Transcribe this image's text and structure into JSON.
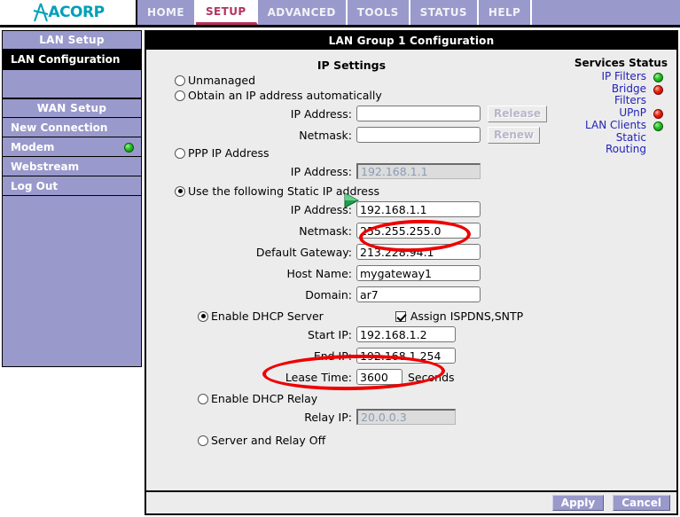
{
  "brand": {
    "name": "ACORP",
    "logo_icon": "acorp-logo-icon"
  },
  "nav": {
    "items": [
      {
        "label": "HOME",
        "active": false
      },
      {
        "label": "SETUP",
        "active": true
      },
      {
        "label": "ADVANCED",
        "active": false
      },
      {
        "label": "TOOLS",
        "active": false
      },
      {
        "label": "STATUS",
        "active": false
      },
      {
        "label": "HELP",
        "active": false
      }
    ]
  },
  "sidebar": {
    "groups": [
      {
        "header": "LAN Setup",
        "items": [
          {
            "label": "LAN Configuration",
            "selected": true,
            "led": null
          }
        ]
      },
      {
        "header": "WAN Setup",
        "items": [
          {
            "label": "New Connection",
            "selected": false,
            "led": null
          },
          {
            "label": "Modem",
            "selected": false,
            "led": "green"
          },
          {
            "label": "Webstream",
            "selected": false,
            "led": null
          },
          {
            "label": "Log Out",
            "selected": false,
            "led": null
          }
        ]
      }
    ]
  },
  "content": {
    "title": "LAN Group 1 Configuration",
    "section_title": "IP Settings"
  },
  "services": {
    "header": "Services Status",
    "rows": [
      {
        "label": "IP Filters",
        "status": "green"
      },
      {
        "label": "Bridge Filters",
        "status": "red"
      },
      {
        "label": "UPnP",
        "status": "red"
      },
      {
        "label": "LAN Clients",
        "status": "green"
      },
      {
        "label": "Static Routing",
        "status": "none"
      }
    ]
  },
  "form": {
    "unmanaged": {
      "label": "Unmanaged",
      "selected": false
    },
    "obtain_auto": {
      "label": "Obtain an IP address automatically",
      "selected": false
    },
    "auto_ip": {
      "label": "IP Address:",
      "value": "",
      "placeholder": ""
    },
    "auto_netmask": {
      "label": "Netmask:",
      "value": "",
      "placeholder": ""
    },
    "release_button": "Release",
    "renew_button": "Renew",
    "ppp": {
      "label": "PPP IP Address",
      "selected": false
    },
    "ppp_ip": {
      "label": "IP Address:",
      "value": "192.168.1.1"
    },
    "static": {
      "label": "Use the following Static IP address",
      "selected": true
    },
    "static_ip": {
      "label": "IP Address:",
      "value": "192.168.1.1"
    },
    "static_netmask": {
      "label": "Netmask:",
      "value": "255.255.255.0"
    },
    "default_gateway": {
      "label": "Default Gateway:",
      "value": "213.228.94.1"
    },
    "host_name": {
      "label": "Host Name:",
      "value": "mygateway1"
    },
    "domain": {
      "label": "Domain:",
      "value": "ar7"
    },
    "dhcp_server": {
      "label": "Enable DHCP Server",
      "selected": true
    },
    "assign_isp": {
      "label": "Assign ISPDNS,SNTP",
      "checked": true
    },
    "start_ip": {
      "label": "Start IP:",
      "value": "192.168.1.2"
    },
    "end_ip": {
      "label": "End IP:",
      "value": "192.168.1.254"
    },
    "lease_time": {
      "label": "Lease Time:",
      "value": "3600",
      "unit": "Seconds"
    },
    "dhcp_relay": {
      "label": "Enable DHCP Relay",
      "selected": false
    },
    "relay_ip": {
      "label": "Relay IP:",
      "value": "20.0.0.3"
    },
    "relay_off": {
      "label": "Server and Relay Off",
      "selected": false
    }
  },
  "footer": {
    "apply_label": "Apply",
    "cancel_label": "Cancel"
  },
  "annotations": {
    "ip_address_highlight": "red-ellipse-around-static-ip-address",
    "start_ip_highlight": "red-ellipse-around-start-ip"
  },
  "colors": {
    "nav_bg": "#9999cc",
    "active_tab_text": "#b4335c",
    "link": "#2222bb",
    "led_green": "#27c427",
    "led_red": "#e8200c",
    "annotation": "#ee0000",
    "logo": "#00a0b8"
  }
}
